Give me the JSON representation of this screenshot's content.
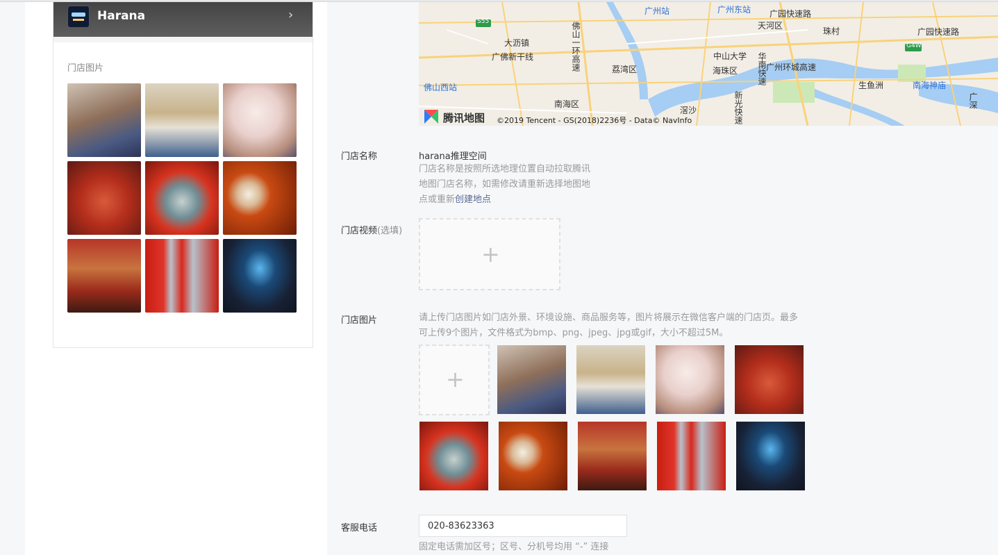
{
  "preview": {
    "store_name": "Harana",
    "chevron": "›",
    "photos_label": "门店图片"
  },
  "map": {
    "labels": [
      "广州站",
      "广州东站",
      "广园快速路",
      "天河区",
      "珠村",
      "广园快速路",
      "大沥镇",
      "广佛新干线",
      "佛山一环高速",
      "荔湾区",
      "中山大学",
      "海珠区",
      "华南快速",
      "广州环城高速",
      "生鱼洲",
      "南海神庙",
      "佛山西站",
      "南海区",
      "新光快速",
      "滘沙",
      "广深"
    ],
    "road_badges": [
      "S55",
      "G4W"
    ],
    "logo_text": "腾讯地图",
    "copyright": "©2019 Tencent - GS(2018)2236号 - Data© NavInfo"
  },
  "form": {
    "store_name_label": "门店名称",
    "store_name_value": "harana推理空间",
    "store_name_hint_1": "门店名称是按照所选地理位置自动拉取腾讯",
    "store_name_hint_2": "地图门店名称，如需修改请重新选择地图地",
    "store_name_hint_3": "点或重新",
    "create_location_link": "创建地点",
    "video_label": "门店视频",
    "video_optional": "(选填)",
    "video_upload_plus": "+",
    "photos_label": "门店图片",
    "photos_hint_1": "请上传门店图片如门店外景、环境设施、商品服务等，图片将展示在微信客户端的门店页。最多",
    "photos_hint_2": "可上传9个图片，文件格式为bmp、png、jpeg、jpg或gif，大小不超过5M。",
    "photos_upload_plus": "+",
    "phone_label": "客服电话",
    "phone_value": "020-83623363",
    "phone_hint": "固定电话需加区号；区号、分机号均用 “-” 连接"
  },
  "colors": {
    "link": "#576b95",
    "hint": "#9a9a9a",
    "map_water": "#a6cdf3",
    "map_road": "#f9d27a"
  }
}
